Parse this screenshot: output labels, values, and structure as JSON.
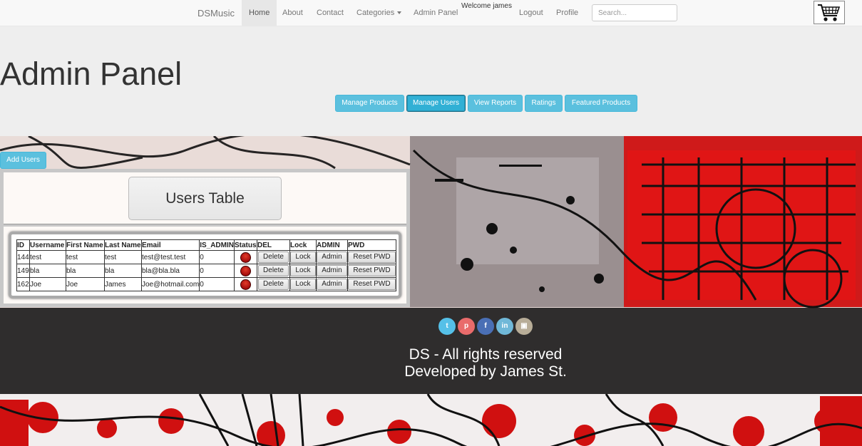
{
  "navbar": {
    "brand": "DSMusic",
    "items": [
      {
        "label": "Home"
      },
      {
        "label": "About"
      },
      {
        "label": "Contact"
      },
      {
        "label": "Categories"
      },
      {
        "label": "Admin Panel"
      },
      {
        "label": "Logout"
      },
      {
        "label": "Profile"
      }
    ],
    "welcome": "Welcome james",
    "search_placeholder": "Search...",
    "cart_icon": "shopping-cart-icon"
  },
  "jumbotron": {
    "title": "Admin Panel",
    "buttons": [
      {
        "label": "Manage Products"
      },
      {
        "label": "Manage Users",
        "active": true
      },
      {
        "label": "View Reports"
      },
      {
        "label": "Ratings"
      },
      {
        "label": "Featured Products"
      }
    ]
  },
  "users_panel": {
    "add_button": "Add Users",
    "title": "Users Table",
    "columns": [
      "ID",
      "Username",
      "First Name",
      "Last Name",
      "Email",
      "IS_ADMIN",
      "Status",
      "DEL",
      "Lock",
      "ADMIN",
      "PWD"
    ],
    "row_buttons": {
      "delete": "Delete",
      "lock": "Lock",
      "admin": "Admin",
      "reset": "Reset PWD"
    },
    "rows": [
      {
        "id": "144",
        "username": "test",
        "first": "test",
        "last": "test",
        "email": "test@test.test",
        "is_admin": "0"
      },
      {
        "id": "149",
        "username": "bla",
        "first": "bla",
        "last": "bla",
        "email": "bla@bla.bla",
        "is_admin": "0"
      },
      {
        "id": "162",
        "username": "Joe",
        "first": "Joe",
        "last": "James",
        "email": "Joe@hotmail.com",
        "is_admin": "0"
      }
    ]
  },
  "footer": {
    "social_icons": [
      "twitter-icon",
      "pinterest-icon",
      "facebook-icon",
      "linkedin-icon",
      "instagram-icon"
    ],
    "line1": "DS - All rights reserved",
    "line2": "Developed by James St."
  },
  "colors": {
    "accent": "#5bc0de",
    "status_red": "#c0150f",
    "footer_bg": "#141414"
  }
}
